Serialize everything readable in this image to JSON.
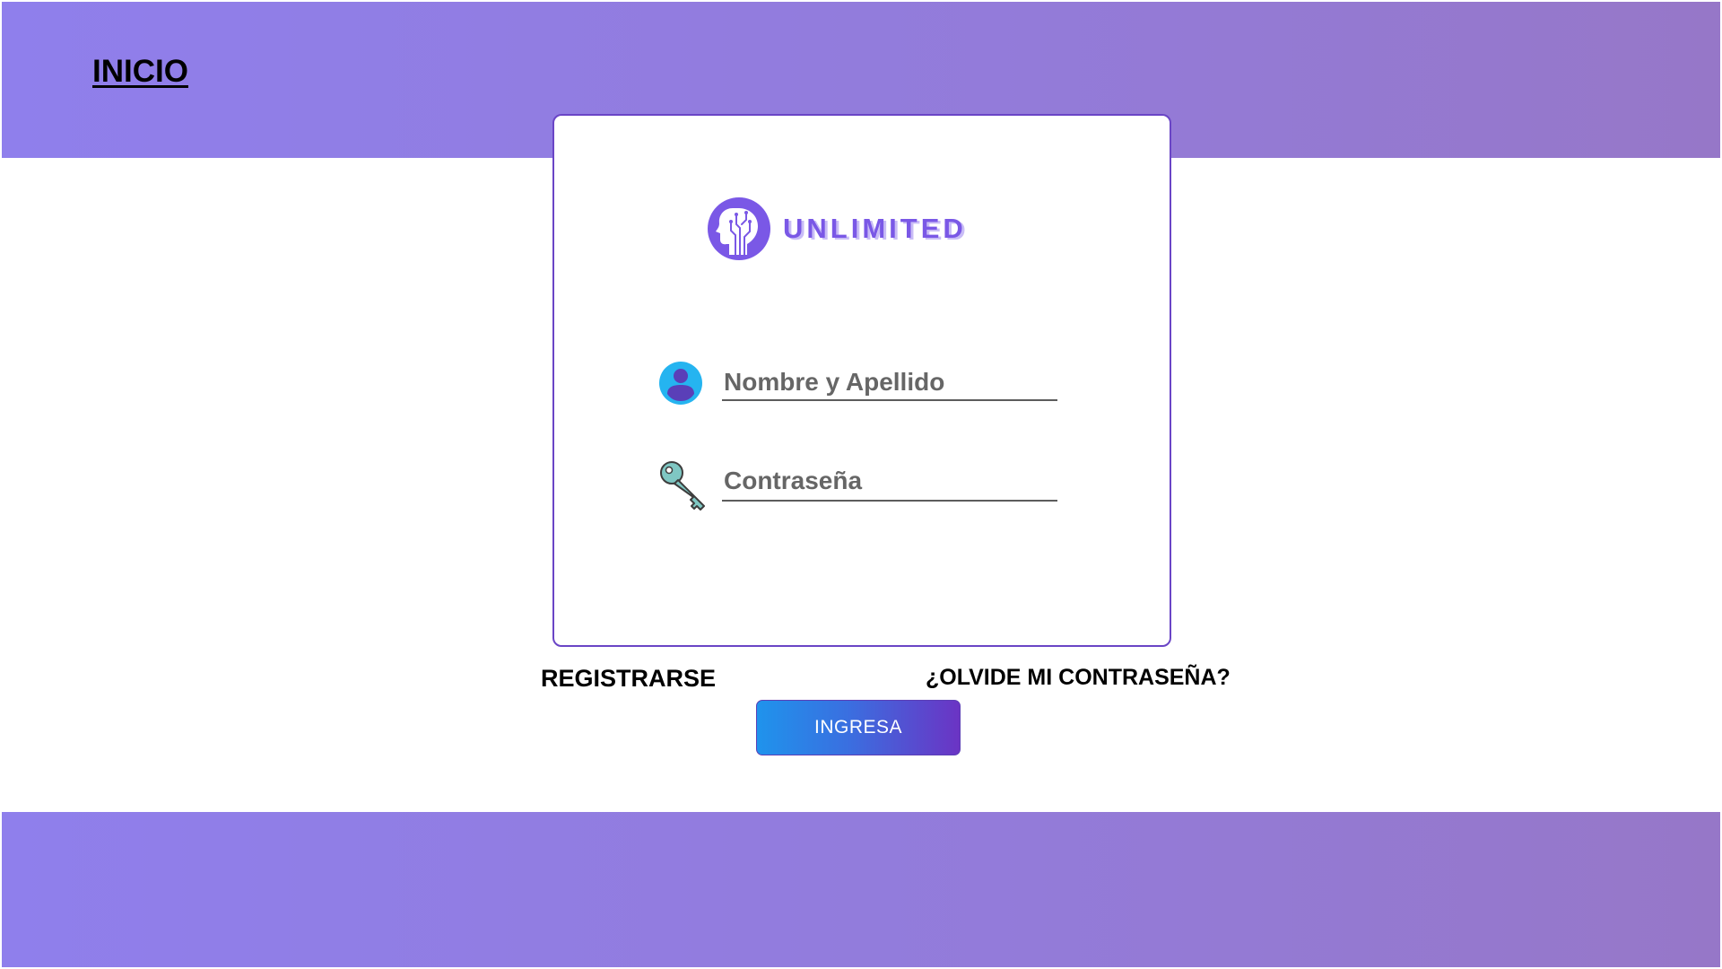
{
  "header": {
    "home_link": "INICIO"
  },
  "login_card": {
    "logo": {
      "icon": "brain-head-circuit-icon",
      "text": "UNLIMITED"
    },
    "username": {
      "icon": "user-avatar-icon",
      "placeholder": "Nombre y Apellido",
      "value": ""
    },
    "password": {
      "icon": "key-icon",
      "placeholder": "Contraseña",
      "value": ""
    }
  },
  "actions": {
    "register_label": "REGISTRARSE",
    "forgot_password_label": "¿OLVIDE MI CONTRASEÑA?",
    "submit_label": "INGRESA"
  },
  "colors": {
    "band_gradient_start": "#8f7fec",
    "band_gradient_end": "#9677c8",
    "card_border": "#6a45c6",
    "logo_purple": "#7a58e6",
    "button_gradient_start": "#1f93ec",
    "button_gradient_end": "#6b34c4"
  }
}
